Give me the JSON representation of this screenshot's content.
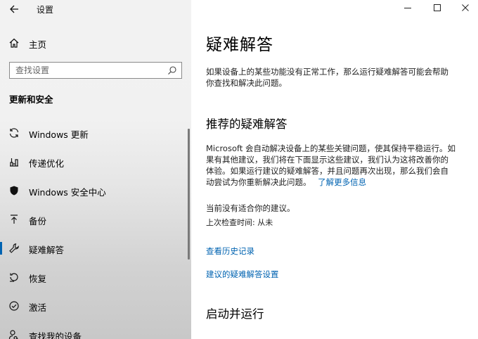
{
  "window": {
    "title": "设置",
    "back_icon": "arrow-left-icon",
    "controls": [
      "minimize-icon",
      "maximize-icon",
      "close-icon"
    ]
  },
  "sidebar": {
    "home_label": "主页",
    "search_placeholder": "查找设置",
    "section_title": "更新和安全",
    "items": [
      {
        "label": "Windows 更新",
        "icon": "sync-icon",
        "active": false
      },
      {
        "label": "传递优化",
        "icon": "delivery-optimization-icon",
        "active": false
      },
      {
        "label": "Windows 安全中心",
        "icon": "shield-icon",
        "active": false
      },
      {
        "label": "备份",
        "icon": "backup-arrow-icon",
        "active": false
      },
      {
        "label": "疑难解答",
        "icon": "wrench-icon",
        "active": true
      },
      {
        "label": "恢复",
        "icon": "recovery-icon",
        "active": false
      },
      {
        "label": "激活",
        "icon": "check-circle-icon",
        "active": false
      },
      {
        "label": "查找我的设备",
        "icon": "person-search-icon",
        "active": false
      }
    ]
  },
  "main": {
    "title": "疑难解答",
    "intro_line1": "如果设备上的某些功能没有正常工作，那么运行疑难解答可能会帮助",
    "intro_line2": "你查找和解决此问题。",
    "recommended_heading": "推荐的疑难解答",
    "rec_line1": "Microsoft 会自动解决设备上的某些关键问题，使其保持平稳运行。如",
    "rec_line2": "果有其他建议，我们将在下面显示这些建议，我们认为这将改善你的",
    "rec_line3": "体验。如果运行建议的疑难解答，并且问题再次出现，那么我们会自",
    "rec_line4": "动尝试为你重新解决此问题。",
    "learn_more_link": "了解更多信息",
    "no_suggestion": "当前没有适合你的建议。",
    "last_checked": "上次检查时间: 从未",
    "history_link": "查看历史记录",
    "settings_link": "建议的疑难解答设置",
    "run_heading": "启动并运行"
  }
}
